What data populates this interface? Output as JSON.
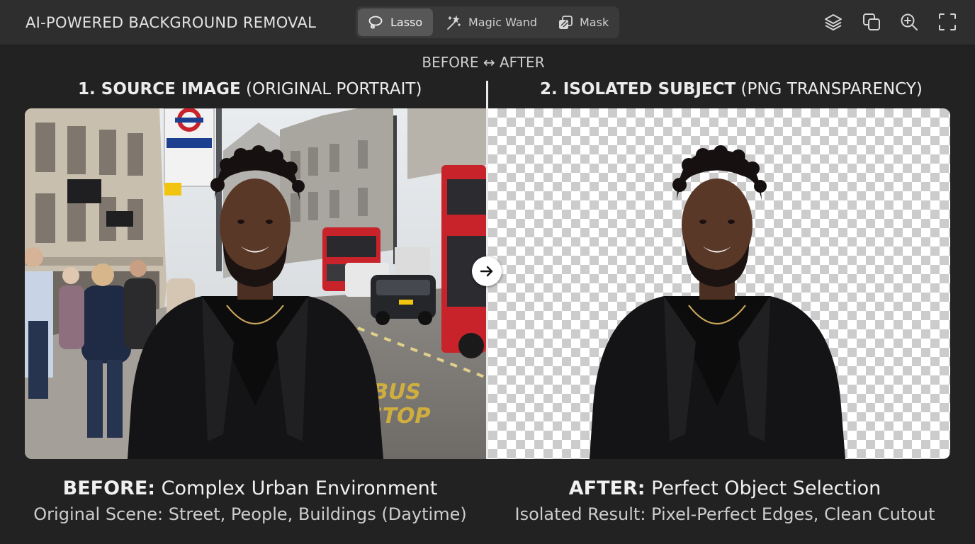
{
  "header": {
    "title": "AI-POWERED BACKGROUND REMOVAL",
    "tools": [
      {
        "label": "Lasso",
        "icon": "lasso-icon",
        "active": true
      },
      {
        "label": "Magic Wand",
        "icon": "magic-wand-icon",
        "active": false
      },
      {
        "label": "Mask",
        "icon": "mask-icon",
        "active": false
      }
    ],
    "actions": [
      "layers-icon",
      "duplicate-icon",
      "zoom-in-icon",
      "fullscreen-icon"
    ]
  },
  "compare": {
    "label": "BEFORE ↔ AFTER",
    "left": {
      "title_bold": "1. SOURCE IMAGE",
      "title_rest": " (ORIGINAL PORTRAIT)",
      "caption_bold": "BEFORE:",
      "caption_rest": " Complex Urban Environment",
      "subcaption": "Original Scene: Street, People, Buildings (Daytime)"
    },
    "right": {
      "title_bold": "2. ISOLATED SUBJECT",
      "title_rest": " (PNG TRANSPARENCY)",
      "caption_bold": "AFTER:",
      "caption_rest": " Perfect Object Selection",
      "subcaption": "Isolated Result: Pixel-Perfect Edges, Clean Cutout"
    },
    "bus_stop_marking": "BUS STOP"
  },
  "colors": {
    "background": "#222222",
    "topbar": "#2e2e2e",
    "active_tool": "#575757",
    "bus_red": "#c8232b"
  }
}
